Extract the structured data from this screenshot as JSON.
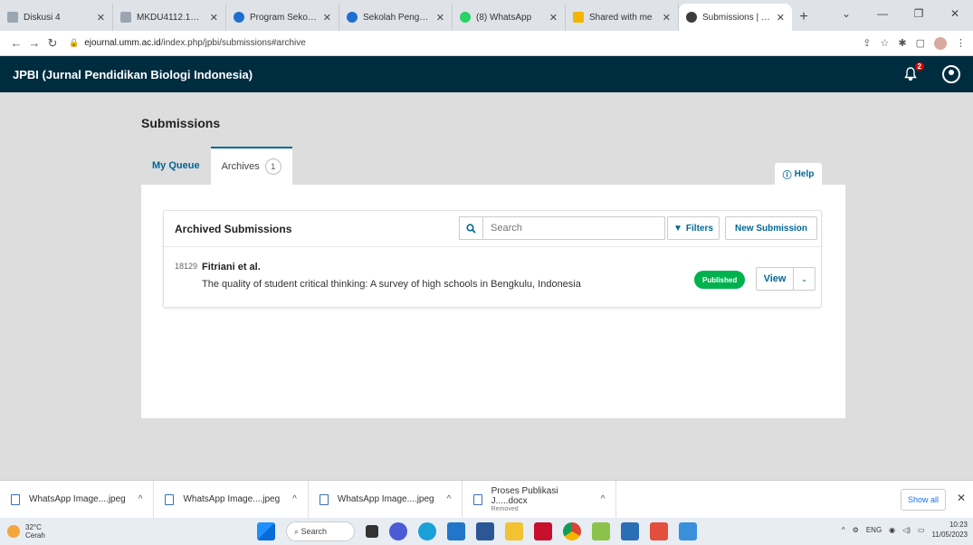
{
  "browser": {
    "tabs": [
      {
        "title": "Diskusi 4",
        "color": "#9aa5b1"
      },
      {
        "title": "MKDU4112.12:T...",
        "color": "#9aa5b1"
      },
      {
        "title": "Program Sekolah ...",
        "color": "#1f6fd1"
      },
      {
        "title": "Sekolah Pengge...",
        "color": "#1f6fd1"
      },
      {
        "title": "(8) WhatsApp",
        "color": "#25d366"
      },
      {
        "title": "Shared with me",
        "color": "#f4b400"
      },
      {
        "title": "Submissions | JP...",
        "color": "#3c3c3c"
      }
    ],
    "url_host": "ejournal.umm.ac.id",
    "url_path": "/index.php/jpbi/submissions#archive"
  },
  "app": {
    "brand": "JPBI (Jurnal Pendidikan Biologi Indonesia)",
    "notification_count": "2"
  },
  "page": {
    "title": "Submissions",
    "tabs": [
      {
        "label": "My Queue"
      },
      {
        "label": "Archives",
        "badge": "1"
      }
    ],
    "help_label": "Help"
  },
  "archived": {
    "title": "Archived Submissions",
    "search_placeholder": "Search",
    "filters_label": "Filters",
    "new_submission_label": "New Submission",
    "rows": [
      {
        "id": "18129",
        "author": "Fitriani et al.",
        "title": "The quality of student critical thinking: A survey of high schools in Bengkulu, Indonesia",
        "status": "Published",
        "view_label": "View"
      }
    ]
  },
  "downloads": {
    "items": [
      {
        "name": "WhatsApp Image....jpeg",
        "sub": ""
      },
      {
        "name": "WhatsApp Image....jpeg",
        "sub": ""
      },
      {
        "name": "WhatsApp Image....jpeg",
        "sub": ""
      },
      {
        "name": "Proses Publikasi J.....docx",
        "sub": "Removed"
      }
    ],
    "show_all_label": "Show all"
  },
  "taskbar": {
    "temp": "32°C",
    "condition": "Cerah",
    "search_label": "Search",
    "lang": "ENG",
    "time": "10:23",
    "date": "11/05/2023"
  }
}
